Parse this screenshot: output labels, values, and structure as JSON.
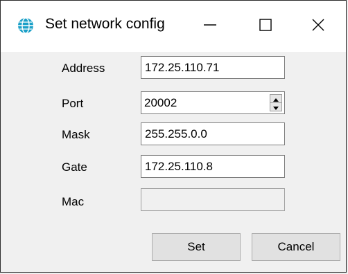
{
  "window": {
    "title": "Set network config",
    "icons": {
      "app": "globe-icon",
      "minimize": "minimize-icon",
      "maximize": "maximize-icon",
      "close": "close-icon"
    }
  },
  "form": {
    "address": {
      "label": "Address",
      "value": "172.25.110.71"
    },
    "port": {
      "label": "Port",
      "value": "20002"
    },
    "mask": {
      "label": "Mask",
      "value": "255.255.0.0"
    },
    "gate": {
      "label": "Gate",
      "value": "172.25.110.8"
    },
    "mac": {
      "label": "Mac",
      "value": ""
    }
  },
  "buttons": {
    "set": "Set",
    "cancel": "Cancel"
  },
  "colors": {
    "titlebar": "#ffffff",
    "body": "#f0f0f0",
    "button": "#e1e1e1",
    "icon_accent": "#1ba0c8"
  }
}
